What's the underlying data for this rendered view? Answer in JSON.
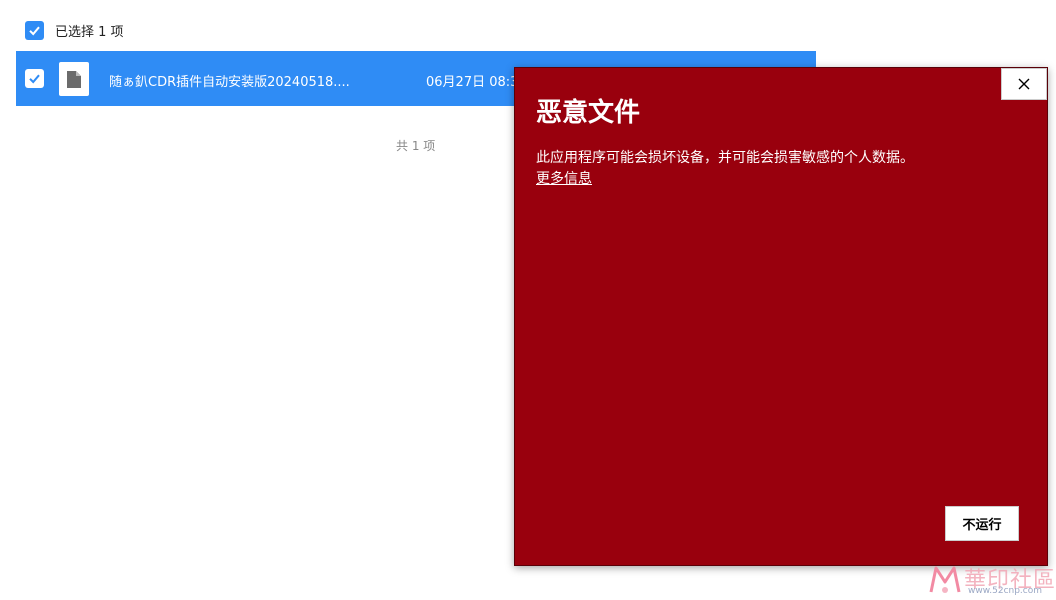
{
  "selection": {
    "label": "已选择 1 项",
    "checked": true
  },
  "file_row": {
    "name": "随ぁ釟CDR插件自动安装版20240518....",
    "date": "06月27日 08:3",
    "checked": true,
    "icon": "file-icon"
  },
  "footer": {
    "total": "共 1 项"
  },
  "dialog": {
    "title": "恶意文件",
    "message": "此应用程序可能会损坏设备，并可能会损害敏感的个人数据。",
    "link": "更多信息",
    "button": "不运行",
    "close_icon": "close-icon",
    "background": "#99000d"
  },
  "colors": {
    "accent": "#2f8cf5",
    "danger": "#99000d"
  },
  "watermark": {
    "text": "華印社區",
    "url": "www.52cnp.com"
  }
}
